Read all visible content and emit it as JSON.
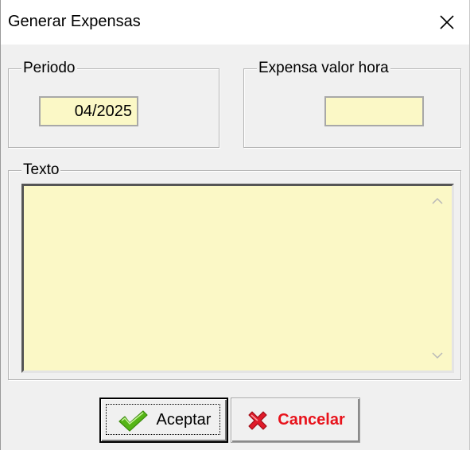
{
  "window": {
    "title": "Generar Expensas",
    "close_icon": "close-icon"
  },
  "periodo": {
    "label": "Periodo",
    "value": "04/2025"
  },
  "expensa_valor_hora": {
    "label": "Expensa valor hora",
    "value": ""
  },
  "texto": {
    "label": "Texto",
    "value": ""
  },
  "buttons": {
    "accept_label": "Aceptar",
    "accept_icon": "checkmark-icon",
    "cancel_label": "Cancelar",
    "cancel_icon": "x-cross-icon"
  },
  "colors": {
    "field_background": "#fbf8c6",
    "cancel_text": "#e8121b",
    "check_green": "#55b515",
    "cross_red": "#e01b2a"
  }
}
